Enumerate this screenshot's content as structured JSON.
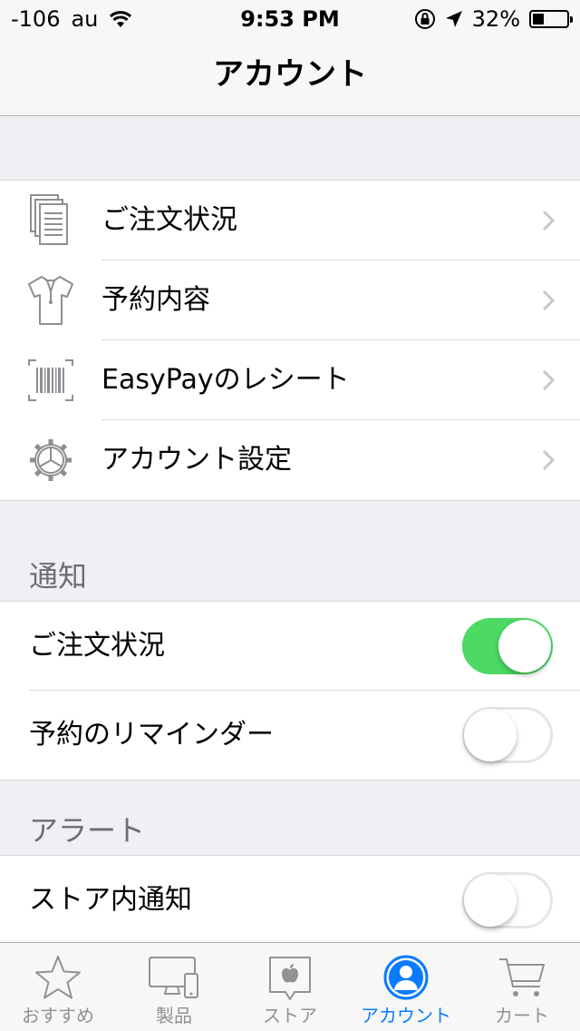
{
  "status_bar": {
    "signal": "-106",
    "carrier": "au",
    "time": "9:53 PM",
    "battery_percent": "32%",
    "battery_level": 0.32
  },
  "navbar": {
    "title": "アカウント"
  },
  "menu": [
    {
      "label": "ご注文状況",
      "icon": "documents-icon"
    },
    {
      "label": "予約内容",
      "icon": "shirt-icon"
    },
    {
      "label": "EasyPayのレシート",
      "icon": "barcode-icon"
    },
    {
      "label": "アカウント設定",
      "icon": "gear-icon"
    }
  ],
  "notifications": {
    "header": "通知",
    "items": [
      {
        "label": "ご注文状況",
        "on": true
      },
      {
        "label": "予約のリマインダー",
        "on": false
      }
    ]
  },
  "alerts": {
    "header": "アラート",
    "items": [
      {
        "label": "ストア内通知",
        "on": false
      }
    ]
  },
  "tabbar": {
    "tabs": [
      {
        "label": "おすすめ",
        "icon": "star-icon",
        "active": false
      },
      {
        "label": "製品",
        "icon": "devices-icon",
        "active": false
      },
      {
        "label": "ストア",
        "icon": "apple-store-icon",
        "active": false
      },
      {
        "label": "アカウント",
        "icon": "account-icon",
        "active": true
      },
      {
        "label": "カート",
        "icon": "cart-icon",
        "active": false
      }
    ]
  },
  "colors": {
    "accent": "#0a7bff",
    "toggle_on": "#4cd964",
    "inactive": "#929292"
  }
}
